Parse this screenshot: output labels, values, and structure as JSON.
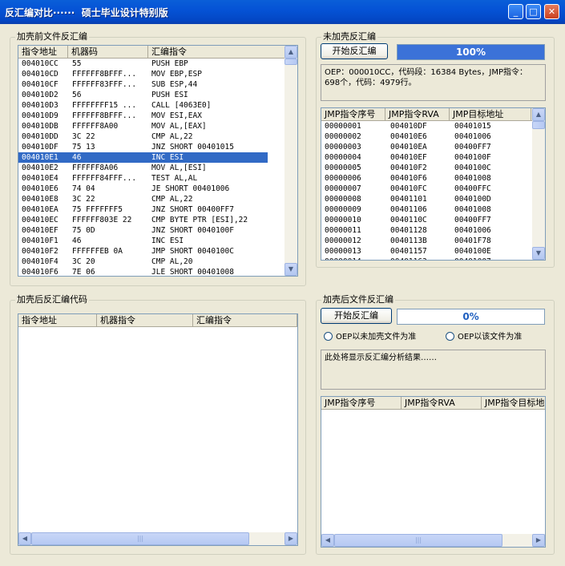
{
  "window": {
    "title": "反汇编对比······  硕士毕业设计特别版",
    "min_glyph": "_",
    "max_glyph": "□",
    "close_glyph": "✕"
  },
  "before": {
    "group_label": "加壳前文件反汇编",
    "columns": [
      "指令地址",
      "机器码",
      "汇编指令"
    ],
    "selected_index": 9,
    "rows": [
      [
        "004010CC",
        "55",
        "PUSH EBP"
      ],
      [
        "004010CD",
        "FFFFFF8BFFF...",
        "MOV EBP,ESP"
      ],
      [
        "004010CF",
        "FFFFFF83FFF...",
        "SUB ESP,44"
      ],
      [
        "004010D2",
        "56",
        "PUSH ESI"
      ],
      [
        "004010D3",
        "FFFFFFFF15 ...",
        "CALL [4063E0]"
      ],
      [
        "004010D9",
        "FFFFFF8BFFF...",
        "MOV ESI,EAX"
      ],
      [
        "004010DB",
        "FFFFFF8A00",
        "MOV AL,[EAX]"
      ],
      [
        "004010DD",
        "3C 22",
        "CMP AL,22"
      ],
      [
        "004010DF",
        "75 13",
        "JNZ SHORT 00401015"
      ],
      [
        "004010E1",
        "46",
        "INC ESI"
      ],
      [
        "004010E2",
        "FFFFFF8A06",
        "MOV AL,[ESI]"
      ],
      [
        "004010E4",
        "FFFFFF84FFF...",
        "TEST AL,AL"
      ],
      [
        "004010E6",
        "74 04",
        "JE SHORT 00401006"
      ],
      [
        "004010E8",
        "3C 22",
        "CMP AL,22"
      ],
      [
        "004010EA",
        "75 FFFFFFF5",
        "JNZ SHORT 00400FF7"
      ],
      [
        "004010EC",
        "FFFFFF803E 22",
        "CMP BYTE PTR [ESI],22"
      ],
      [
        "004010EF",
        "75 0D",
        "JNZ SHORT 0040100F"
      ],
      [
        "004010F1",
        "46",
        "INC ESI"
      ],
      [
        "004010F2",
        "FFFFFFEB 0A",
        "JMP SHORT 0040100C"
      ],
      [
        "004010F4",
        "3C 20",
        "CMP AL,20"
      ],
      [
        "004010F6",
        "7E 06",
        "JLE SHORT 00401008"
      ]
    ]
  },
  "unpacked": {
    "group_label": "未加壳反汇编",
    "start_button": "开始反汇编",
    "progress_text": "100%",
    "progress_value": 1.0,
    "info": "OEP：000010CC，代码段：16384 Bytes，JMP指令：698个，代码：4979行。",
    "columns": [
      "JMP指令序号",
      "JMP指令RVA",
      "JMP目标地址"
    ],
    "rows": [
      [
        "00000001",
        "004010DF",
        "00401015"
      ],
      [
        "00000002",
        "004010E6",
        "00401006"
      ],
      [
        "00000003",
        "004010EA",
        "00400FF7"
      ],
      [
        "00000004",
        "004010EF",
        "0040100F"
      ],
      [
        "00000005",
        "004010F2",
        "0040100C"
      ],
      [
        "00000006",
        "004010F6",
        "00401008"
      ],
      [
        "00000007",
        "004010FC",
        "00400FFC"
      ],
      [
        "00000008",
        "00401101",
        "0040100D"
      ],
      [
        "00000009",
        "00401106",
        "00401008"
      ],
      [
        "00000010",
        "0040110C",
        "00400FF7"
      ],
      [
        "00000011",
        "00401128",
        "00401006"
      ],
      [
        "00000012",
        "0040113B",
        "00401F78"
      ],
      [
        "00000013",
        "00401157",
        "0040100E"
      ],
      [
        "00000014",
        "00401163",
        "00401007"
      ]
    ]
  },
  "after": {
    "group_label": "加壳后反汇编代码",
    "columns": [
      "指令地址",
      "机器指令",
      "汇编指令"
    ]
  },
  "packed": {
    "group_label": "加壳后文件反汇编",
    "start_button": "开始反汇编",
    "progress_text": "0%",
    "progress_value": 0.0,
    "radio1": "OEP以未加壳文件为准",
    "radio2": "OEP以该文件为准",
    "info": "此处将显示反汇编分析结果……",
    "columns": [
      "JMP指令序号",
      "JMP指令RVA",
      "JMP指令目标地"
    ]
  },
  "colors": {
    "selection": "#316ac5",
    "progress": "#3b72d8",
    "title_bar": "#0553d6",
    "progress_text_zero": "#1f5fbf"
  }
}
